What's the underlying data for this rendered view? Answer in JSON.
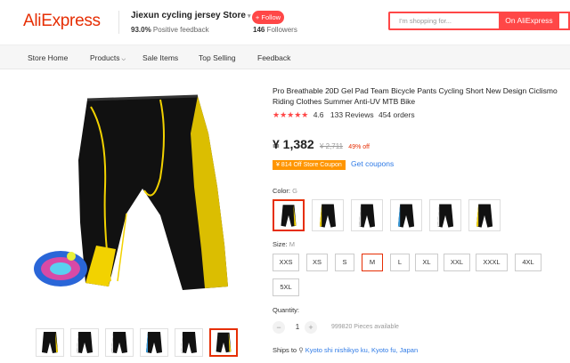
{
  "header": {
    "logo": "AliExpress",
    "store_name": "Jiexun cycling jersey Store",
    "feedback_pct": "93.0%",
    "feedback_label": "Positive feedback",
    "follow_label": "+ Follow",
    "followers_count": "146",
    "followers_label": "Followers",
    "search_placeholder": "I'm shopping for...",
    "search_button": "On AliExpress"
  },
  "nav": {
    "items": [
      "Store Home",
      "Products",
      "Sale Items",
      "Top Selling",
      "Feedback"
    ]
  },
  "product": {
    "title": "Pro Breathable 20D Gel Pad Team Bicycle Pants Cycling Short New Design Ciclismo Riding Clothes Summer Anti-UV MTB Bike",
    "stars": "★★★★★",
    "rating": "4.6",
    "reviews": "133 Reviews",
    "orders": "454 orders",
    "price": "¥ 1,382",
    "old_price": "¥ 2,711",
    "discount": "49% off",
    "coupon": "¥ 814 Off Store Coupon",
    "get_coupons": "Get coupons",
    "color_label": "Color:",
    "color_value": "G",
    "size_label": "Size:",
    "size_value": "M",
    "sizes": [
      "XXS",
      "XS",
      "S",
      "M",
      "L",
      "XL",
      "XXL",
      "XXXL",
      "4XL",
      "5XL"
    ],
    "selected_size": "M",
    "quantity_label": "Quantity:",
    "quantity": "1",
    "available": "999820 Pieces available",
    "ships_label": "Ships to",
    "ships_location": "Kyoto shi nishikyo ku, Kyoto fu, Japan"
  },
  "colors": {
    "accent": "#ff4747",
    "brand": "#e62e04",
    "link": "#2e7ae6",
    "coupon": "#ff9500",
    "short_yellow": "#f2d200"
  }
}
